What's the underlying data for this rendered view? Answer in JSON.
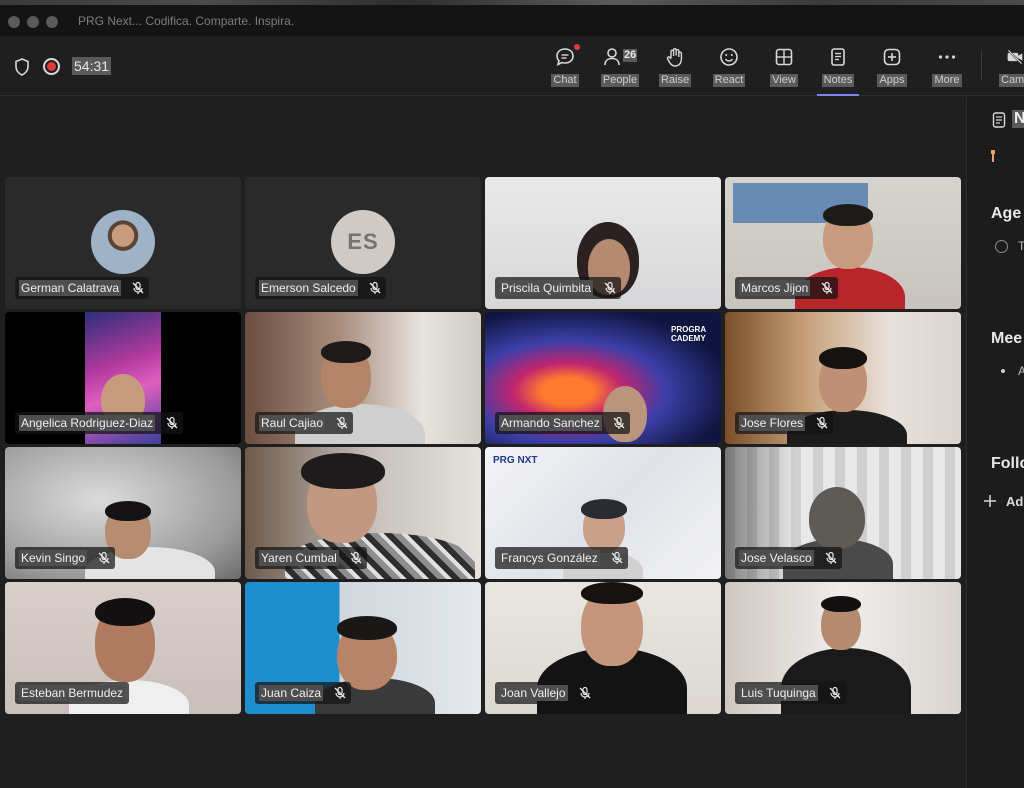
{
  "window": {
    "title": "PRG Next... Codifica. Comparte. Inspira."
  },
  "meeting": {
    "timer": "54:31",
    "participant_count": "26"
  },
  "toolbar": {
    "chat": "Chat",
    "people": "People",
    "raise": "Raise",
    "react": "React",
    "view": "View",
    "notes": "Notes",
    "apps": "Apps",
    "more": "More",
    "camera": "Came"
  },
  "participants": [
    {
      "name": "German Calatrava"
    },
    {
      "name": "Emerson Salcedo",
      "initials": "ES"
    },
    {
      "name": "Priscila Quimbita"
    },
    {
      "name": "Marcos Jijon"
    },
    {
      "name": "Angelica Rodriguez-Diaz"
    },
    {
      "name": "Raul Cajiao"
    },
    {
      "name": "Armando Sanchez",
      "brand": "PROGRA CADEMY"
    },
    {
      "name": "Jose Flores"
    },
    {
      "name": "Kevin Singo"
    },
    {
      "name": "Yaren Cumbal"
    },
    {
      "name": "Francys González",
      "brand": "PRG NXT"
    },
    {
      "name": "Jose Velasco"
    },
    {
      "name": "Esteban Bermudez"
    },
    {
      "name": "Juan Caiza"
    },
    {
      "name": "Joan Vallejo"
    },
    {
      "name": "Luis Tuquinga"
    }
  ],
  "notes_panel": {
    "title": "N",
    "agenda": "Age",
    "agenda_item": "T",
    "meeting_notes": "Mee",
    "meeting_bullet": "A",
    "follow_up": "Follo",
    "add": "Ad"
  },
  "colors": {
    "accent": "#7f85f5",
    "record": "#e03a3a",
    "background": "#1f1f1f"
  }
}
